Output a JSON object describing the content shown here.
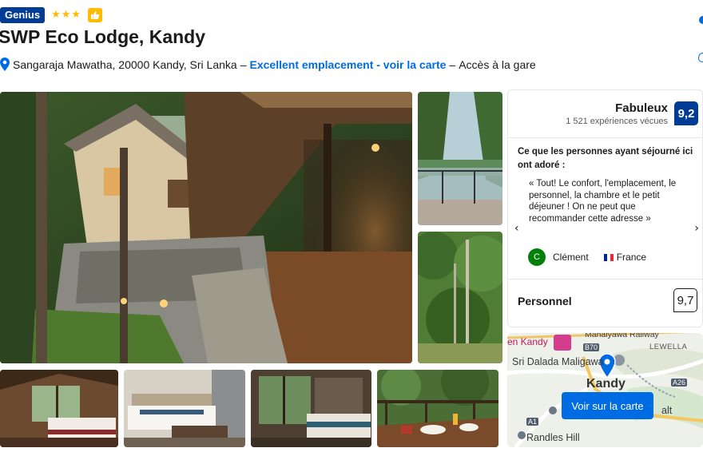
{
  "header": {
    "genius_badge": "Genius",
    "star_rating": 3,
    "stars_text": "★★★",
    "preferred_icon": "thumbs-up-icon",
    "hotel_name": "SWP Eco Lodge, Kandy",
    "address": "Sangaraja Mawatha, 20000 Kandy, Sri Lanka",
    "separator": "–",
    "location_link": "Excellent emplacement - voir la carte",
    "station_text": "Accès à la gare"
  },
  "photos": {
    "main": "lodge-exterior-photo",
    "side": [
      "balcony-view-photo",
      "forest-photo"
    ],
    "thumbs": [
      "room-photo-1",
      "room-photo-2",
      "room-photo-3",
      "dining-terrace-photo"
    ]
  },
  "review_panel": {
    "score_label": "Fabuleux",
    "review_count": "1 521 expériences vécues",
    "score": "9,2",
    "loved_heading": "Ce que les personnes ayant séjourné ici ont adoré :",
    "quote": "« Tout! Le confort, l'emplacement, le personnel, la chambre et le petit déjeuner ! On ne peut que recommander cette adresse »",
    "prev_arrow": "‹",
    "next_arrow": "›",
    "reviewer_initial": "C",
    "reviewer_name": "Clément",
    "reviewer_country": "France",
    "category_label": "Personnel",
    "category_score": "9,7"
  },
  "map": {
    "labels": {
      "railway": "Mahaiyawa Railway",
      "area1": "LEWELLA",
      "place1": "en Kandy",
      "road1": "B70",
      "temple": "Sri Dalada Maligawa",
      "city": "Kandy",
      "road2": "A26",
      "road3": "A1",
      "partial": "alt",
      "area2": "Randles Hill"
    },
    "button_label": "Voir sur la carte"
  },
  "colors": {
    "brand_blue": "#003b95",
    "link_blue": "#006ce4",
    "star_yellow": "#febb02",
    "avatar_green": "#008009"
  }
}
